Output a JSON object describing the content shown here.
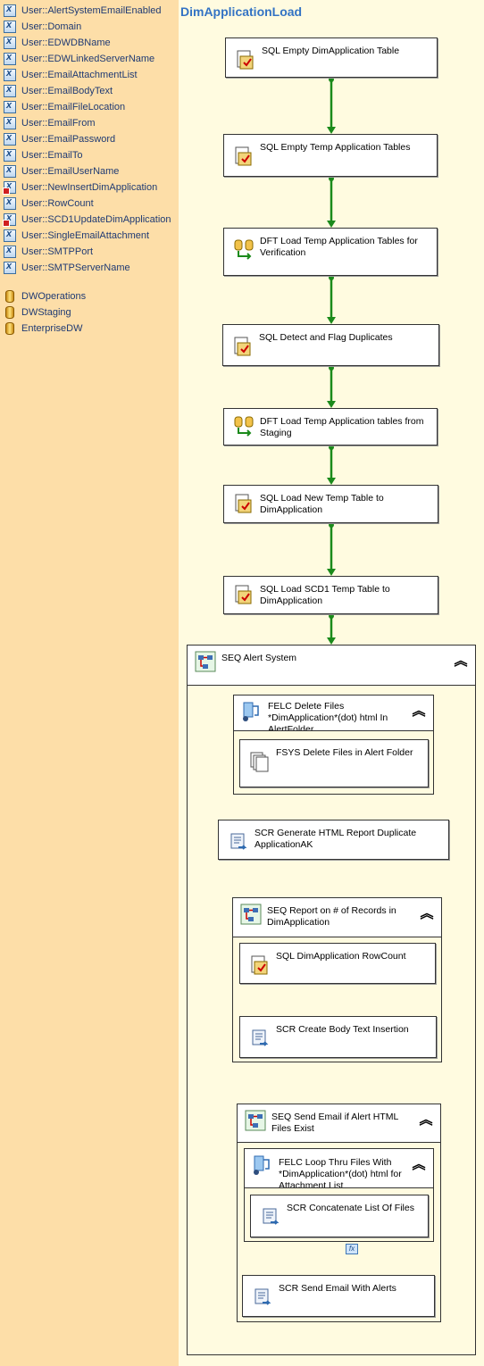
{
  "variables": [
    {
      "label": "User::AlertSystemEmailEnabled",
      "icon": "variable-icon"
    },
    {
      "label": "User::Domain",
      "icon": "variable-icon"
    },
    {
      "label": "User::EDWDBName",
      "icon": "variable-icon"
    },
    {
      "label": "User::EDWLinkedServerName",
      "icon": "variable-icon"
    },
    {
      "label": "User::EmailAttachmentList",
      "icon": "variable-icon"
    },
    {
      "label": "User::EmailBodyText",
      "icon": "variable-icon"
    },
    {
      "label": "User::EmailFileLocation",
      "icon": "variable-icon"
    },
    {
      "label": "User::EmailFrom",
      "icon": "variable-icon"
    },
    {
      "label": "User::EmailPassword",
      "icon": "variable-icon"
    },
    {
      "label": "User::EmailTo",
      "icon": "variable-icon"
    },
    {
      "label": "User::EmailUserName",
      "icon": "variable-icon"
    },
    {
      "label": "User::NewInsertDimApplication",
      "icon": "variable-flagged-icon"
    },
    {
      "label": "User::RowCount",
      "icon": "variable-icon"
    },
    {
      "label": "User::SCD1UpdateDimApplication",
      "icon": "variable-flagged-icon"
    },
    {
      "label": "User::SingleEmailAttachment",
      "icon": "variable-icon"
    },
    {
      "label": "User::SMTPPort",
      "icon": "variable-icon"
    },
    {
      "label": "User::SMTPServerName",
      "icon": "variable-icon"
    }
  ],
  "connections": [
    {
      "label": "DWOperations",
      "icon": "database-icon"
    },
    {
      "label": "DWStaging",
      "icon": "database-icon"
    },
    {
      "label": "EnterpriseDW",
      "icon": "database-icon"
    }
  ],
  "package_title": "DimApplicationLoad",
  "tasks": {
    "sql_empty_dim": "SQL Empty DimApplication Table",
    "sql_empty_temp": "SQL Empty Temp Application Tables",
    "dft_load_verify": "DFT Load Temp Application Tables for Verification",
    "sql_detect_dupes": "SQL Detect and Flag Duplicates",
    "dft_load_staging": "DFT Load Temp Application tables from Staging",
    "sql_load_new": "SQL Load New Temp Table to DimApplication",
    "sql_load_scd1": "SQL Load SCD1 Temp Table to DimApplication",
    "seq_alert": "SEQ Alert System",
    "felc_delete": "FELC Delete Files *DimApplication*(dot) html In AlertFolder",
    "fsys_delete": "FSYS Delete Files in Alert Folder",
    "scr_generate": "SCR Generate HTML Report Duplicate ApplicationAK",
    "seq_report": "SEQ Report on # of Records in DimApplication",
    "sql_rowcount": "SQL DimApplication RowCount",
    "scr_body": "SCR Create Body Text Insertion",
    "seq_send": "SEQ Send Email if Alert HTML Files Exist",
    "felc_loop": "FELC Loop Thru Files With *DimApplication*(dot) html for Attachment List",
    "scr_concat": "SCR Concatenate List Of Files",
    "scr_send": "SCR Send Email With Alerts"
  },
  "collapse_glyph": "︽",
  "expression_badge": "fx",
  "colors": {
    "sidebar_bg": "#FDDEA8",
    "canvas_bg": "#FFFBE0",
    "precedence_arrow": "#1B8A1B",
    "title": "#3373C4"
  }
}
